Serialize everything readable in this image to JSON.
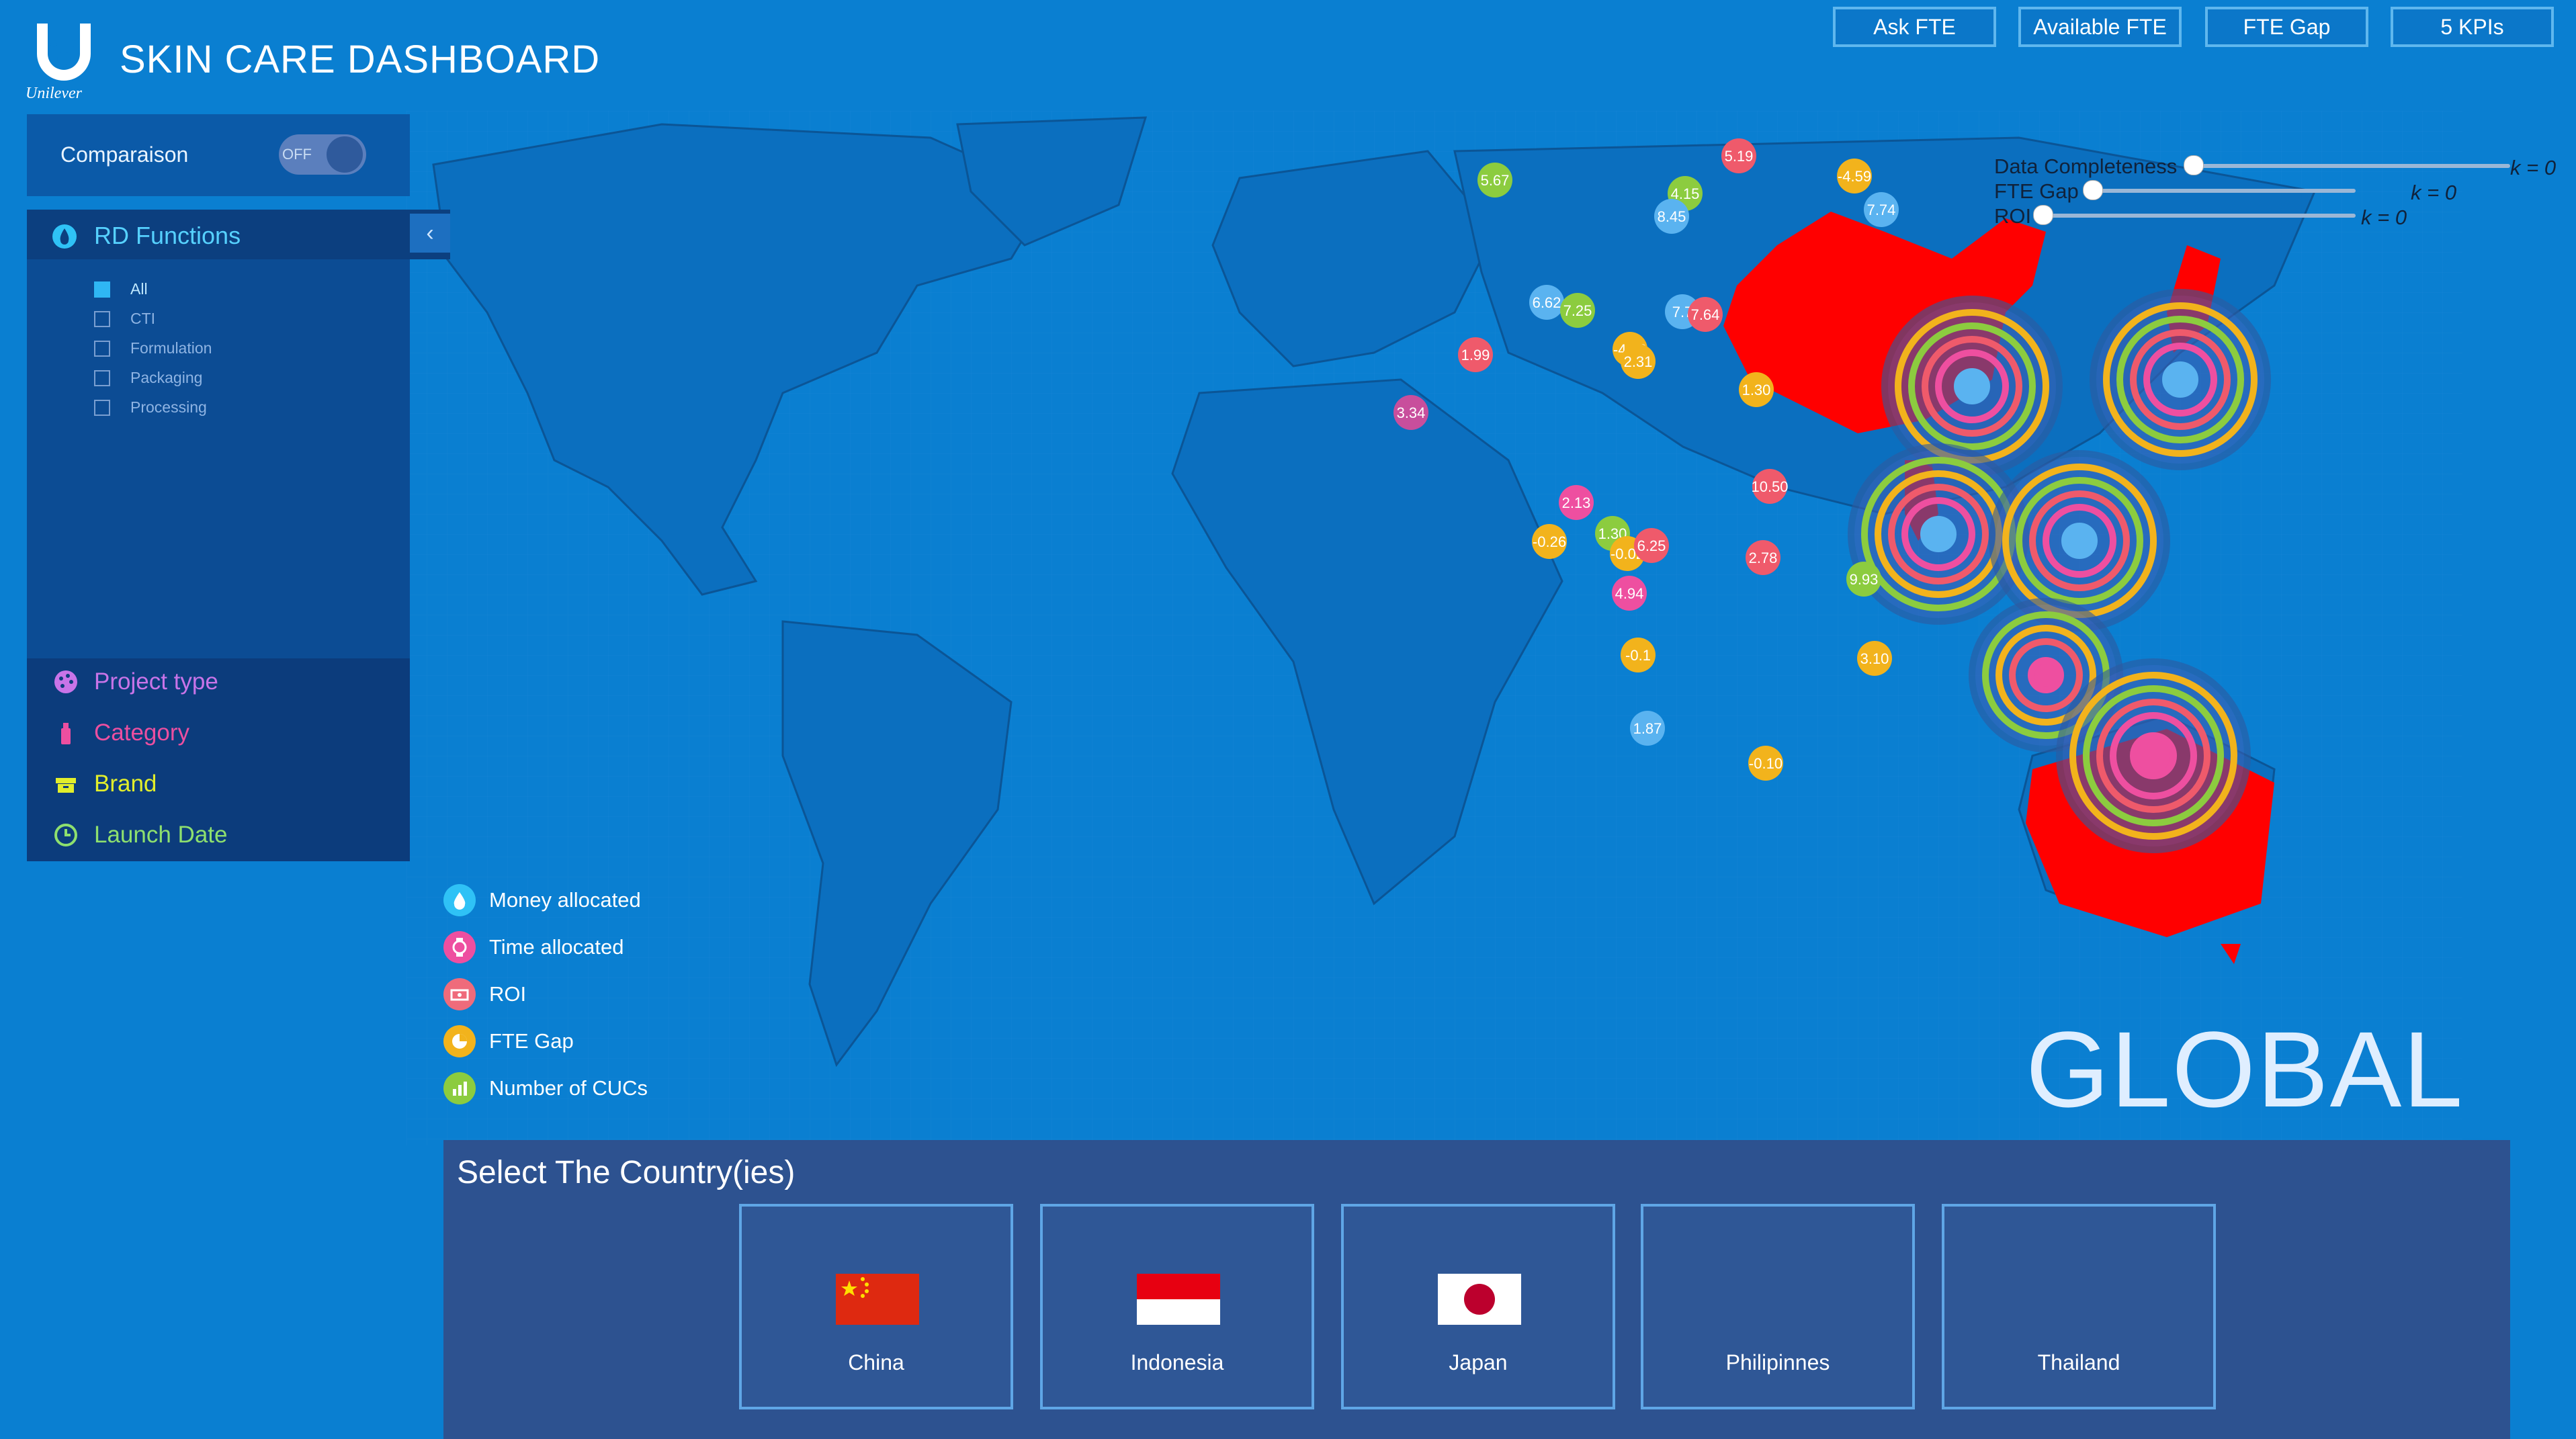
{
  "header": {
    "brand": "Unilever",
    "title": "SKIN CARE DASHBOARD",
    "buttons": [
      "Ask FTE",
      "Available FTE",
      "FTE Gap",
      "5 KPIs"
    ]
  },
  "comparison": {
    "label": "Comparaison",
    "toggle_text": "OFF",
    "enabled": false
  },
  "rd_functions": {
    "title": "RD Functions",
    "collapse_glyph": "‹",
    "options": [
      {
        "label": "All",
        "checked": true
      },
      {
        "label": "CTI",
        "checked": false
      },
      {
        "label": "Formulation",
        "checked": false
      },
      {
        "label": "Packaging",
        "checked": false
      },
      {
        "label": "Processing",
        "checked": false
      }
    ]
  },
  "filters": [
    {
      "label": "Project type",
      "color": "#c874e8",
      "icon": "palette-icon"
    },
    {
      "label": "Category",
      "color": "#ec4fa0",
      "icon": "bottle-icon"
    },
    {
      "label": "Brand",
      "color": "#e2ee2b",
      "icon": "box-icon"
    },
    {
      "label": "Launch Date",
      "color": "#8ee06e",
      "icon": "clock-icon"
    }
  ],
  "legend": [
    {
      "label": "Money allocated",
      "color": "#2fc2f6",
      "icon": "drop-icon"
    },
    {
      "label": "Time allocated",
      "color": "#ee4fa0",
      "icon": "watch-icon"
    },
    {
      "label": "ROI",
      "color": "#ef6b7b",
      "icon": "money-icon"
    },
    {
      "label": "FTE Gap",
      "color": "#f2b31c",
      "icon": "pie-icon"
    },
    {
      "label": "Number of CUCs",
      "color": "#8ccc3f",
      "icon": "chart-icon"
    }
  ],
  "sliders": [
    {
      "label": "Data Completeness",
      "k": "k = 0"
    },
    {
      "label": "FTE Gap",
      "k": "k = 0"
    },
    {
      "label": "ROI",
      "k": "k = 0"
    }
  ],
  "map": {
    "region_label": "GLOBAL",
    "highlight_color": "#ff0000",
    "bubble_labels": [
      {
        "value": "5.67",
        "color": "#8ccc3f"
      },
      {
        "value": "5.19",
        "color": "#ef5a6b"
      },
      {
        "value": "-4.59",
        "color": "#f2b31c"
      },
      {
        "value": "4.15",
        "color": "#8ccc3f"
      },
      {
        "value": "8.45",
        "color": "#5ab3f0"
      },
      {
        "value": "7.74",
        "color": "#5ab3f0"
      },
      {
        "value": "6.62",
        "color": "#5ab3f0"
      },
      {
        "value": "7.25",
        "color": "#8ccc3f"
      },
      {
        "value": "7.7",
        "color": "#5ab3f0"
      },
      {
        "value": "7.64",
        "color": "#ef5a6b"
      },
      {
        "value": "1.99",
        "color": "#ef5a6b"
      },
      {
        "value": "-4.49",
        "color": "#f2b31c"
      },
      {
        "value": "2.31",
        "color": "#f2b31c"
      },
      {
        "value": "3.34",
        "color": "#c84e9c"
      },
      {
        "value": "1.30",
        "color": "#f2b31c"
      },
      {
        "value": "10.50",
        "color": "#ef5a6b"
      },
      {
        "value": "2.13",
        "color": "#ee4fa0"
      },
      {
        "value": "-0.26",
        "color": "#f2b31c"
      },
      {
        "value": "1.30",
        "color": "#8ccc3f"
      },
      {
        "value": "-0.02",
        "color": "#f2b31c"
      },
      {
        "value": "6.25",
        "color": "#ef5a6b"
      },
      {
        "value": "2.78",
        "color": "#ef5a6b"
      },
      {
        "value": "4.94",
        "color": "#ee4fa0"
      },
      {
        "value": "9.93",
        "color": "#8ccc3f"
      },
      {
        "value": "-0.1",
        "color": "#f2b31c"
      },
      {
        "value": "3.10",
        "color": "#f2b31c"
      },
      {
        "value": "1.87",
        "color": "#5ab3f0"
      },
      {
        "value": "-0.10",
        "color": "#f2b31c"
      }
    ]
  },
  "country_selector": {
    "title": "Select The Country(ies)",
    "countries": [
      "China",
      "Indonesia",
      "Japan",
      "Philipinnes",
      "Thailand"
    ]
  }
}
